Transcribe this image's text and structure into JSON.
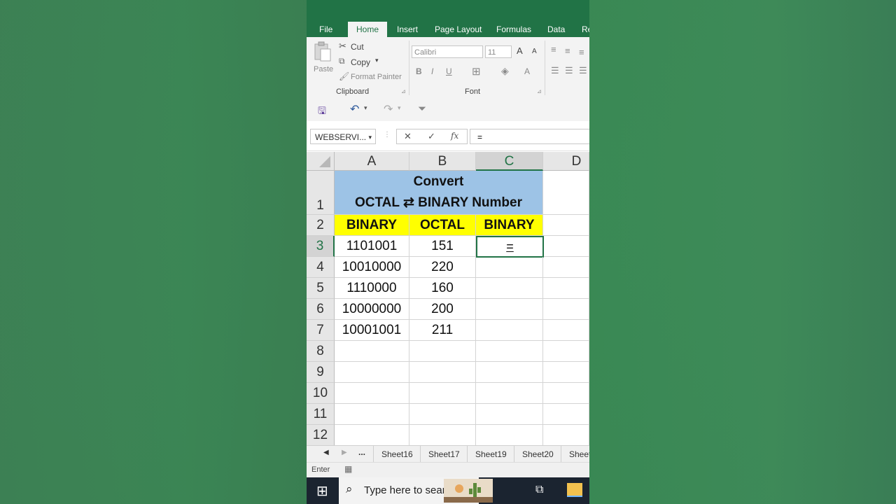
{
  "ribbon": {
    "tabs": [
      "File",
      "Home",
      "Insert",
      "Page Layout",
      "Formulas",
      "Data",
      "Re"
    ],
    "clipboard": {
      "paste": "Paste",
      "cut": "Cut",
      "copy": "Copy",
      "format_painter": "Format Painter",
      "label": "Clipboard"
    },
    "font": {
      "name": "Calibri",
      "size": "11",
      "bold": "B",
      "italic": "I",
      "underline": "U",
      "grow": "A",
      "shrink": "A",
      "color": "A",
      "label": "Font"
    }
  },
  "formula_bar": {
    "name_box": "WEBSERVI...",
    "cancel": "✕",
    "enter": "✓",
    "fx": "fx",
    "content": "="
  },
  "sheet": {
    "columns": [
      "A",
      "B",
      "C",
      "D"
    ],
    "rows": [
      "1",
      "2",
      "3",
      "4",
      "5",
      "6",
      "7",
      "8",
      "9",
      "10",
      "11",
      "12"
    ],
    "title_line1": "Convert",
    "title_line2": "OCTAL ⇄ BINARY Number",
    "headers": [
      "BINARY",
      "OCTAL",
      "BINARY"
    ],
    "data": [
      [
        "1101001",
        "151"
      ],
      [
        "10010000",
        "220"
      ],
      [
        "1110000",
        "160"
      ],
      [
        "10000000",
        "200"
      ],
      [
        "10001001",
        "211"
      ]
    ],
    "active_cell_text": "="
  },
  "sheet_tabs": [
    "...",
    "Sheet16",
    "Sheet17",
    "Sheet19",
    "Sheet20",
    "Sheet"
  ],
  "status": {
    "mode": "Enter"
  },
  "taskbar": {
    "search_placeholder": "Type here to search"
  },
  "colors": {
    "excel_green": "#217346",
    "title_fill": "#9dc3e6",
    "header_fill": "#ffff00"
  }
}
